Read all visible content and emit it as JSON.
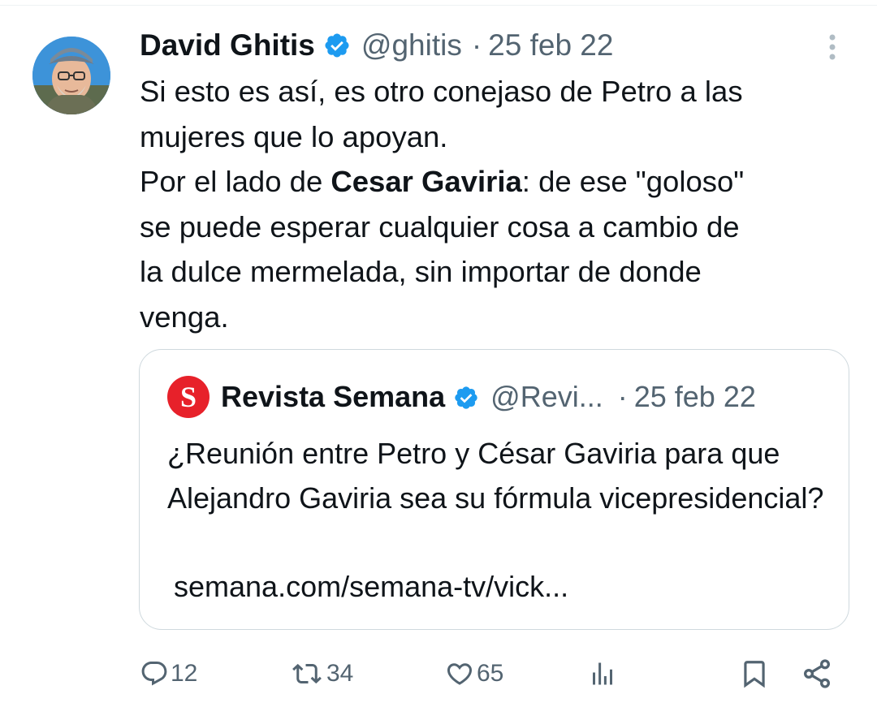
{
  "tweet": {
    "author": {
      "name": "David Ghitis",
      "handle": "@ghitis",
      "avatar_icon": "profile-photo"
    },
    "separator": "·",
    "date": "25 feb 22",
    "text": {
      "line1": "Si esto es así, es otro conejaso de Petro a las",
      "line2": "mujeres que lo apoyan.",
      "line3_prefix": "Por el lado de ",
      "line3_bold": "Cesar Gaviria",
      "line3_suffix": ": de ese \"goloso\"",
      "line4": "se puede esperar cualquier cosa a cambio de",
      "line5": "la dulce mermelada, sin importar de donde",
      "line6": "venga."
    },
    "quote": {
      "avatar_letter": "S",
      "name": "Revista Semana",
      "handle": "@Revi...",
      "separator": "·",
      "date": "25 feb 22",
      "text": "¿Reunión entre Petro y César Gaviria para que Alejandro Gaviria sea su fórmula vicepresidencial?",
      "link": "semana.com/semana-tv/vick..."
    },
    "actions": {
      "replies": "12",
      "retweets": "34",
      "likes": "65"
    }
  },
  "colors": {
    "text": "#0f1419",
    "secondary": "#536471",
    "verified": "#1d9bf0",
    "border": "#cfd9de",
    "semana_red": "#e7212a"
  }
}
